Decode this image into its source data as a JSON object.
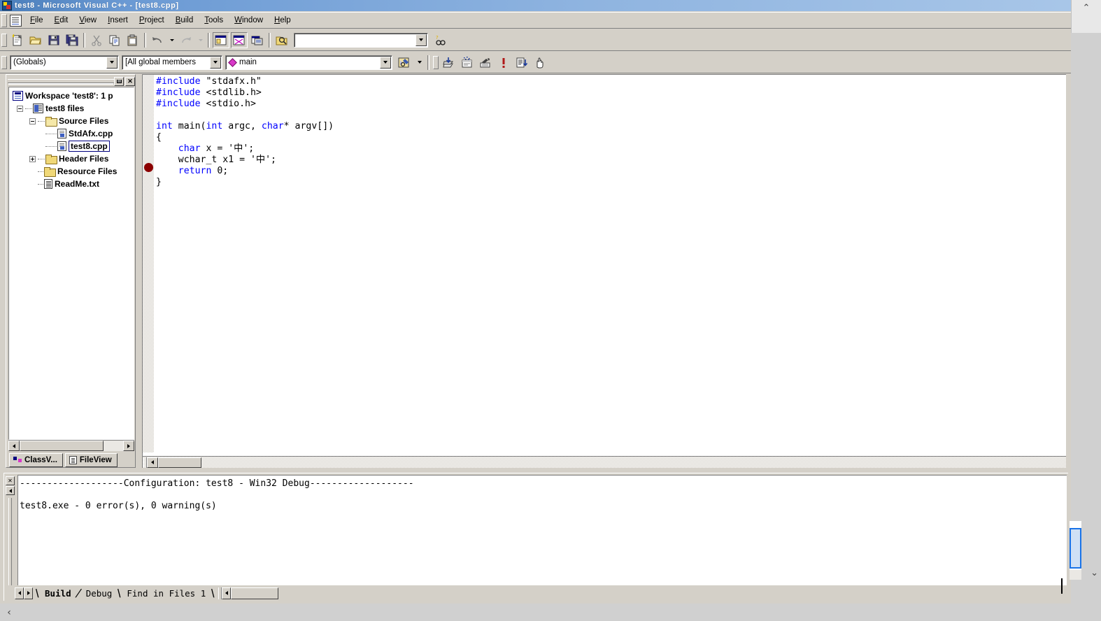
{
  "window": {
    "title": "test8 - Microsoft Visual C++ - [test8.cpp]",
    "app_icon": "visual-cpp-icon",
    "title_chevron": "⌃"
  },
  "menubar": {
    "doc_icon": "document-icon",
    "items": [
      {
        "label": "File"
      },
      {
        "label": "Edit"
      },
      {
        "label": "View"
      },
      {
        "label": "Insert"
      },
      {
        "label": "Project"
      },
      {
        "label": "Build"
      },
      {
        "label": "Tools"
      },
      {
        "label": "Window"
      },
      {
        "label": "Help"
      }
    ]
  },
  "standard_toolbar": {
    "buttons": [
      {
        "name": "new-text-file-icon",
        "tooltip": "New Text File"
      },
      {
        "name": "open-icon",
        "tooltip": "Open"
      },
      {
        "name": "save-icon",
        "tooltip": "Save"
      },
      {
        "name": "save-all-icon",
        "tooltip": "Save All"
      },
      {
        "name": "cut-icon",
        "tooltip": "Cut"
      },
      {
        "name": "copy-icon",
        "tooltip": "Copy"
      },
      {
        "name": "paste-icon",
        "tooltip": "Paste"
      },
      {
        "name": "undo-icon",
        "tooltip": "Undo"
      },
      {
        "name": "redo-icon",
        "tooltip": "Redo"
      },
      {
        "name": "workspace-window-icon",
        "tooltip": "Workspace"
      },
      {
        "name": "output-window-icon",
        "tooltip": "Output"
      },
      {
        "name": "window-list-icon",
        "tooltip": "Window List"
      },
      {
        "name": "find-in-files-icon",
        "tooltip": "Find in Files"
      }
    ],
    "find_box": {
      "value": "",
      "placeholder": ""
    },
    "help_button": {
      "name": "find-help-icon"
    }
  },
  "wizardbar": {
    "scope_combo": {
      "value": "(Globals)"
    },
    "members_combo": {
      "value": "[All global members"
    },
    "symbol_combo": {
      "value": "main",
      "icon": "magenta-diamond-icon"
    },
    "action_button": {
      "name": "wizardbar-action-icon"
    },
    "build_buttons": [
      {
        "name": "compile-icon",
        "tooltip": "Compile"
      },
      {
        "name": "build-icon",
        "tooltip": "Build"
      },
      {
        "name": "stop-build-icon",
        "tooltip": "Stop Build"
      },
      {
        "name": "execute-program-icon",
        "tooltip": "Execute Program"
      },
      {
        "name": "go-icon",
        "tooltip": "Go"
      },
      {
        "name": "insert-breakpoint-icon",
        "tooltip": "Insert/Remove Breakpoint"
      }
    ]
  },
  "workspace": {
    "caption_buttons": [
      {
        "name": "minimize-button",
        "glyph": "▬"
      },
      {
        "name": "close-button",
        "glyph": "✕"
      }
    ],
    "tree": [
      {
        "label": "Workspace 'test8': 1 p",
        "icon": "workspace-icon",
        "depth": 0,
        "expander": "none",
        "selected": false
      },
      {
        "label": "test8 files",
        "icon": "project-icon",
        "depth": 1,
        "expander": "minus",
        "selected": false
      },
      {
        "label": "Source Files",
        "icon": "folder-open-icon",
        "depth": 2,
        "expander": "minus",
        "selected": false
      },
      {
        "label": "StdAfx.cpp",
        "icon": "cpp-file-icon",
        "depth": 3,
        "expander": "none",
        "selected": false
      },
      {
        "label": "test8.cpp",
        "icon": "cpp-file-icon",
        "depth": 3,
        "expander": "none",
        "selected": true
      },
      {
        "label": "Header Files",
        "icon": "folder-icon",
        "depth": 2,
        "expander": "plus",
        "selected": false
      },
      {
        "label": "Resource Files",
        "icon": "folder-icon",
        "depth": 2,
        "expander": "none",
        "selected": false
      },
      {
        "label": "ReadMe.txt",
        "icon": "txt-file-icon",
        "depth": 2,
        "expander": "none",
        "selected": false
      }
    ],
    "tabs": [
      {
        "label": "ClassV...",
        "icon": "classview-icon",
        "active": false
      },
      {
        "label": "FileView",
        "icon": "fileview-icon",
        "active": true
      }
    ]
  },
  "editor": {
    "filename": "test8.cpp",
    "breakpoint_line": 10,
    "lines": [
      [
        {
          "t": "#include ",
          "c": "pp"
        },
        {
          "t": "\"stdafx.h\"",
          "c": ""
        }
      ],
      [
        {
          "t": "#include ",
          "c": "pp"
        },
        {
          "t": "<stdlib.h>",
          "c": ""
        }
      ],
      [
        {
          "t": "#include ",
          "c": "pp"
        },
        {
          "t": "<stdio.h>",
          "c": ""
        }
      ],
      [],
      [
        {
          "t": "int",
          "c": "kw"
        },
        {
          "t": " main(",
          "c": ""
        },
        {
          "t": "int",
          "c": "kw"
        },
        {
          "t": " argc, ",
          "c": ""
        },
        {
          "t": "char",
          "c": "kw"
        },
        {
          "t": "* argv[])",
          "c": ""
        }
      ],
      [
        {
          "t": "{",
          "c": ""
        }
      ],
      [
        {
          "t": "    ",
          "c": ""
        },
        {
          "t": "char",
          "c": "kw"
        },
        {
          "t": " x = '中';",
          "c": ""
        }
      ],
      [
        {
          "t": "    wchar_t x1 = '中';",
          "c": ""
        }
      ],
      [
        {
          "t": "    ",
          "c": ""
        },
        {
          "t": "return",
          "c": "kw"
        },
        {
          "t": " 0;",
          "c": ""
        }
      ],
      [
        {
          "t": "}",
          "c": ""
        }
      ]
    ],
    "colors": {
      "keyword": "#0000ff",
      "preprocessor": "#0000ff",
      "text": "#000000",
      "background": "#ffffff",
      "breakpoint": "#8b0000"
    }
  },
  "output": {
    "close_button": {
      "name": "close-output-button",
      "glyph": "✕"
    },
    "scroll_up_button": {
      "name": "scroll-up-button"
    },
    "text": "-------------------Configuration: test8 - Win32 Debug-------------------\n\ntest8.exe - 0 error(s), 0 warning(s)",
    "tabs": [
      {
        "label": "Build",
        "active": true
      },
      {
        "label": "Debug",
        "active": false
      },
      {
        "label": "Find in Files 1",
        "active": false
      }
    ]
  },
  "overlay_scrollbars": {
    "vertical_chevron": "⌄",
    "horizontal_chevron": "‹"
  }
}
